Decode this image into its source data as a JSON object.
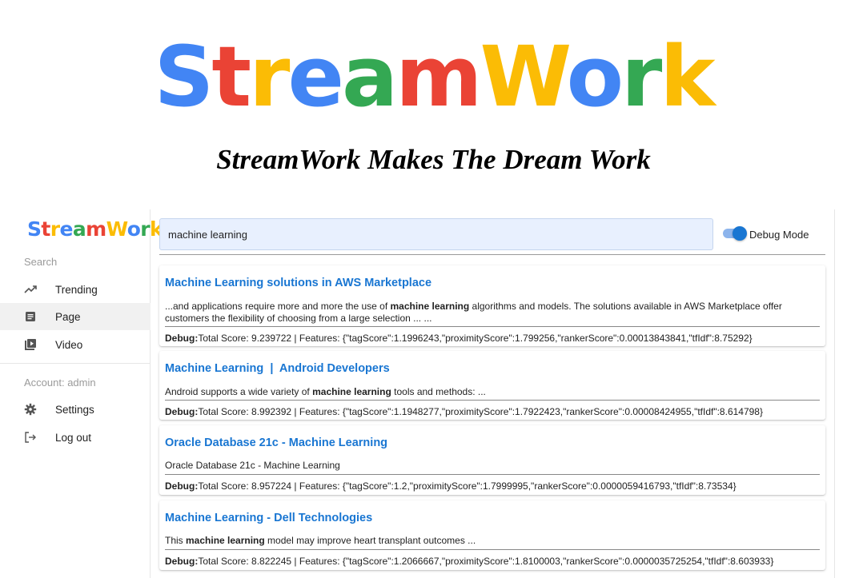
{
  "brand": {
    "name_parts": [
      {
        "text": "S",
        "color": "#4285F4"
      },
      {
        "text": "t",
        "color": "#EA4335"
      },
      {
        "text": "r",
        "color": "#FBBC05"
      },
      {
        "text": "e",
        "color": "#4285F4"
      },
      {
        "text": "a",
        "color": "#34A853"
      },
      {
        "text": "m",
        "color": "#EA4335"
      },
      {
        "text": "W",
        "color": "#FBBC05"
      },
      {
        "text": "o",
        "color": "#4285F4"
      },
      {
        "text": "r",
        "color": "#34A853"
      },
      {
        "text": "k",
        "color": "#FBBC05"
      }
    ],
    "tagline": "StreamWork Makes The Dream Work"
  },
  "sidebar": {
    "search_label": "Search",
    "items": [
      {
        "label": "Trending",
        "icon": "trending-up-icon"
      },
      {
        "label": "Page",
        "icon": "article-icon",
        "active": true
      },
      {
        "label": "Video",
        "icon": "video-library-icon"
      }
    ],
    "account_label": "Account: admin",
    "account_items": [
      {
        "label": "Settings",
        "icon": "gear-icon"
      },
      {
        "label": "Log out",
        "icon": "logout-icon"
      }
    ]
  },
  "search": {
    "value": "machine learning",
    "debug_label": "Debug Mode",
    "debug_on": true
  },
  "results": [
    {
      "title": "Machine Learning solutions in AWS Marketplace",
      "snippet_parts": [
        {
          "text": "...and applications require more and more the use of "
        },
        {
          "text": "machine learning",
          "bold": true
        },
        {
          "text": " algorithms and models. The solutions available in AWS Marketplace offer customers the flexibility of choosing from a large selection ... ..."
        }
      ],
      "debug_label": "Debug:",
      "debug_text": "Total Score: 9.239722 | Features: {\"tagScore\":1.1996243,\"proximityScore\":1.799256,\"rankerScore\":0.00013843841,\"tfIdf\":8.75292}"
    },
    {
      "title": "Machine Learning  |  Android Developers",
      "snippet_parts": [
        {
          "text": "Android supports a wide variety of "
        },
        {
          "text": "machine learning",
          "bold": true
        },
        {
          "text": " tools and methods: ..."
        }
      ],
      "debug_label": "Debug:",
      "debug_text": "Total Score: 8.992392 | Features: {\"tagScore\":1.1948277,\"proximityScore\":1.7922423,\"rankerScore\":0.00008424955,\"tfIdf\":8.614798}"
    },
    {
      "title": "Oracle Database 21c - Machine Learning",
      "snippet_parts": [
        {
          "text": "Oracle Database 21c - Machine Learning"
        }
      ],
      "debug_label": "Debug:",
      "debug_text": "Total Score: 8.957224 | Features: {\"tagScore\":1.2,\"proximityScore\":1.7999995,\"rankerScore\":0.0000059416793,\"tfIdf\":8.73534}"
    },
    {
      "title": "Machine Learning - Dell Technologies",
      "snippet_parts": [
        {
          "text": "This "
        },
        {
          "text": "machine learning",
          "bold": true
        },
        {
          "text": " model may improve heart transplant outcomes ..."
        }
      ],
      "debug_label": "Debug:",
      "debug_text": "Total Score: 8.822245 | Features: {\"tagScore\":1.2066667,\"proximityScore\":1.8100003,\"rankerScore\":0.0000035725254,\"tfIdf\":8.603933}"
    }
  ]
}
